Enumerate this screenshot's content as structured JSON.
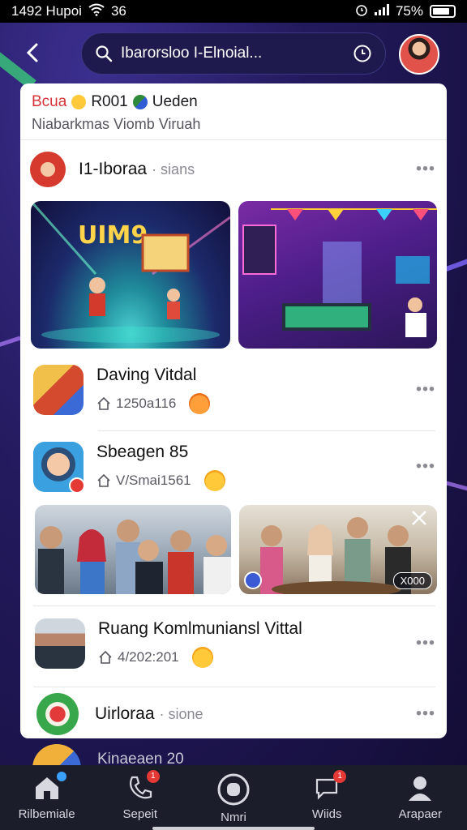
{
  "status_bar": {
    "time_carrier": "1492 Hupoi",
    "signal_value": "36",
    "battery": "75%"
  },
  "search": {
    "text": "Ibarorsloo I-Elnoial..."
  },
  "header": {
    "line1_red": "Bcua",
    "line1_mid": "R001",
    "line1_end": "Ueden",
    "line2": "Niabarkmas Viomb  Viruah"
  },
  "groups": [
    {
      "title": "I1-Iboraa",
      "suffix": "· sians"
    },
    {
      "title": "Daving Vitdal",
      "sub": "1250a116"
    },
    {
      "title": "Sbeagen 85",
      "sub": "V/Smai1561"
    },
    {
      "title": "Ruang Komlmuniansl Vittal",
      "sub": "4/202:201"
    },
    {
      "title": "Uirloraa",
      "suffix": "· sione"
    }
  ],
  "badges": {
    "photo_count": "X000"
  },
  "peek": {
    "title": "Kinaeaen 20"
  },
  "nav": {
    "items": [
      {
        "label": "Rilbemiale",
        "icon": "home-icon"
      },
      {
        "label": "Sepeit",
        "icon": "phone-icon",
        "badge": "1"
      },
      {
        "label": "Nmri",
        "icon": "circle-button-icon"
      },
      {
        "label": "Wiids",
        "icon": "chat-icon",
        "badge": "1"
      },
      {
        "label": "Arapaer",
        "icon": "profile-icon"
      }
    ]
  },
  "colors": {
    "accent_red": "#d4333a",
    "bg_dark": "#231a5e",
    "nav_bg": "#1b1d2b"
  }
}
